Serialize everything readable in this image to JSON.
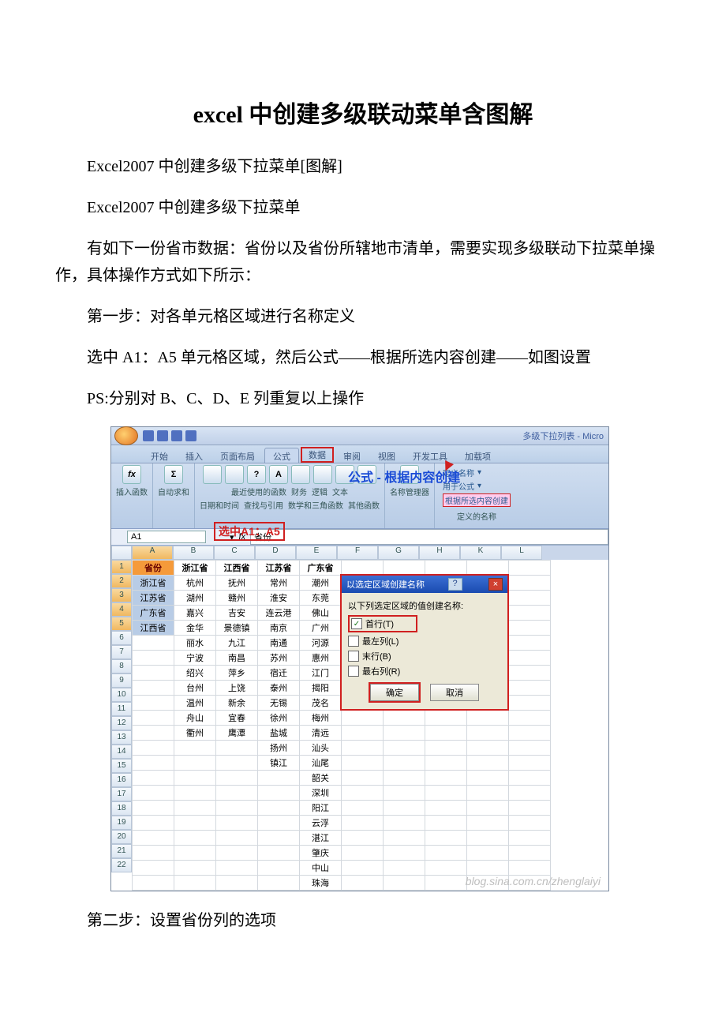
{
  "doc": {
    "title": "excel 中创建多级联动菜单含图解",
    "p1": "Excel2007 中创建多级下拉菜单[图解]",
    "p2": "Excel2007 中创建多级下拉菜单",
    "p3": "有如下一份省市数据：省份以及省份所辖地市清单，需要实现多级联动下拉菜单操作，具体操作方式如下所示：",
    "p4": "第一步：对各单元格区域进行名称定义",
    "p5": "选中 A1：A5 单元格区域，然后公式——根据所选内容创建——如图设置",
    "p6": "PS:分别对 B、C、D、E 列重复以上操作",
    "p7": "第二步：设置省份列的选项"
  },
  "excel": {
    "window_title": "多级下拉列表 - Micro",
    "tabs": [
      "开始",
      "插入",
      "页面布局",
      "公式",
      "数据",
      "审阅",
      "视图",
      "开发工具",
      "加载项"
    ],
    "active_tab": "公式",
    "boxed_tab": "数据",
    "ribbon_fx": "fx",
    "ribbon_sigma": "Σ",
    "ribbon_labels": {
      "insert_fn": "插入函数",
      "autosum": "自动求和",
      "recent": "最近使用的函数",
      "financial": "财务",
      "logical": "逻辑",
      "text": "文本",
      "datetime": "日期和时间",
      "lookup": "查找与引用",
      "math": "数学和三角函数",
      "other": "其他函数",
      "name_mgr": "名称管理器"
    },
    "callout_formula": "公式 - 根据内容创建",
    "defined_names": {
      "define": "定义名称",
      "use_in_formula": "用于公式",
      "create_from_sel": "根据所选内容创建",
      "group_label": "定义的名称"
    },
    "selection_note": "选中A1：A5",
    "namebox": "A1",
    "formula_bar": "省份",
    "columns": [
      "A",
      "B",
      "C",
      "D",
      "E",
      "F",
      "G",
      "H",
      "K",
      "L"
    ],
    "rows": 22,
    "data": {
      "A": [
        "省份",
        "浙江省",
        "江苏省",
        "广东省",
        "江西省"
      ],
      "B": [
        "浙江省",
        "杭州",
        "湖州",
        "嘉兴",
        "金华",
        "丽水",
        "宁波",
        "绍兴",
        "台州",
        "温州",
        "舟山",
        "衢州"
      ],
      "C": [
        "江西省",
        "抚州",
        "赣州",
        "吉安",
        "景德镇",
        "九江",
        "南昌",
        "萍乡",
        "上饶",
        "新余",
        "宜春",
        "鹰潭"
      ],
      "D": [
        "江苏省",
        "常州",
        "淮安",
        "连云港",
        "南京",
        "南通",
        "苏州",
        "宿迁",
        "泰州",
        "无锡",
        "徐州",
        "盐城",
        "扬州",
        "镇江"
      ],
      "E": [
        "广东省",
        "潮州",
        "东莞",
        "佛山",
        "广州",
        "河源",
        "惠州",
        "江门",
        "揭阳",
        "茂名",
        "梅州",
        "清远",
        "汕头",
        "汕尾",
        "韶关",
        "深圳",
        "阳江",
        "云浮",
        "湛江",
        "肇庆",
        "中山",
        "珠海"
      ]
    },
    "dialog": {
      "title": "以选定区域创建名称",
      "subtitle": "以下列选定区域的值创建名称:",
      "opts": {
        "top": "首行(T)",
        "left": "最左列(L)",
        "bottom": "末行(B)",
        "right": "最右列(R)"
      },
      "ok": "确定",
      "cancel": "取消",
      "help_icon": "?"
    },
    "watermark": "blog.sina.com.cn/zhenglaiyi"
  }
}
